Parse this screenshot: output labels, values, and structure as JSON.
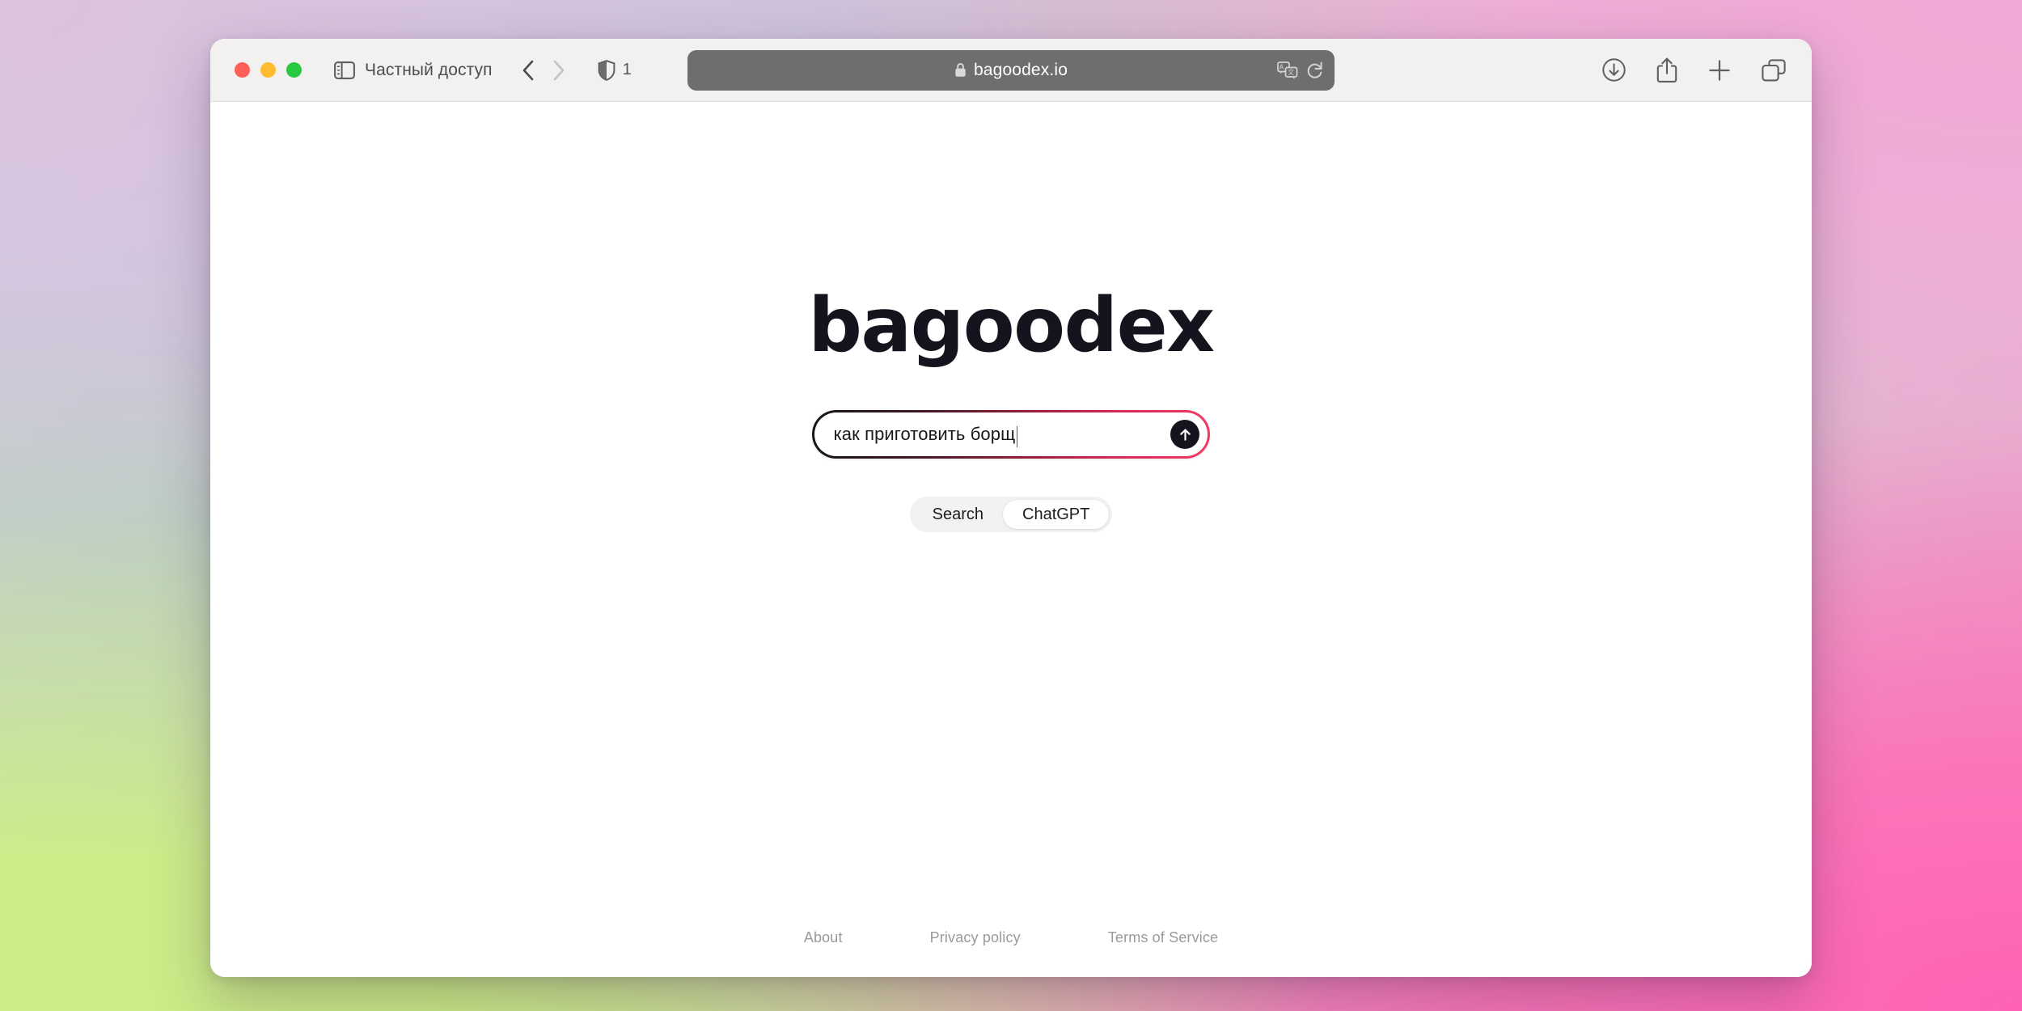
{
  "browser": {
    "window_controls": [
      {
        "name": "close",
        "color": "#ff5f57"
      },
      {
        "name": "minimize",
        "color": "#febc2e"
      },
      {
        "name": "maximize",
        "color": "#28c840"
      }
    ],
    "sidebar_icon": "sidebar-icon",
    "private_browsing_label": "Частный доступ",
    "back_icon": "chevron-left-icon",
    "forward_icon": "chevron-right-icon",
    "shield_icon": "shield-icon",
    "tracker_count": "1",
    "url": {
      "lock_icon": "lock-icon",
      "text": "bagoodex.io",
      "translate_icon": "translate-icon",
      "reload_icon": "reload-icon",
      "field_color": "#6e6e6e"
    },
    "right_actions": [
      {
        "name": "downloads-icon",
        "label": "Downloads"
      },
      {
        "name": "share-icon",
        "label": "Share"
      },
      {
        "name": "new-tab-icon",
        "label": "New Tab"
      },
      {
        "name": "tab-overview-icon",
        "label": "Tab Overview"
      }
    ]
  },
  "site": {
    "logo_text": "bagoodex",
    "logo_color": "#14141e",
    "search": {
      "value": "как приготовить борщ",
      "placeholder": "",
      "submit_icon": "arrow-up-icon",
      "submit_bg": "#14141e",
      "border_gradient_start": "#15151c",
      "border_gradient_end": "#f33a67"
    },
    "mode_toggle": {
      "options": [
        {
          "label": "Search",
          "selected": false
        },
        {
          "label": "ChatGPT",
          "selected": true
        }
      ],
      "track_color": "#f2f2f2",
      "active_color": "#ffffff"
    },
    "footer_links": [
      {
        "label": "About"
      },
      {
        "label": "Privacy policy"
      },
      {
        "label": "Terms of Service"
      }
    ]
  }
}
